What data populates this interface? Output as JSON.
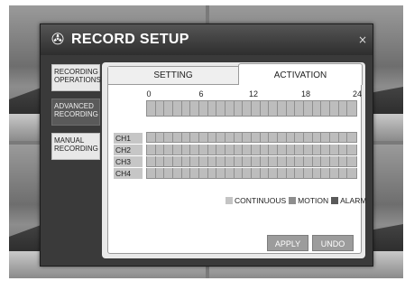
{
  "dialog": {
    "title": "RECORD SETUP",
    "close_symbol": "×",
    "title_icon_glyph": "✇"
  },
  "side_menu": [
    {
      "label": "RECORDING OPERATIONS",
      "active": true
    },
    {
      "label": "ADVANCED RECORDING",
      "active": false
    },
    {
      "label": "MANUAL RECORDING",
      "active": true
    }
  ],
  "tabs": {
    "setting": "SETTING",
    "activation": "ACTIVATION"
  },
  "hours": [
    "0",
    "6",
    "12",
    "18",
    "24"
  ],
  "channels": [
    "CH1",
    "CH2",
    "CH3",
    "CH4"
  ],
  "legend": {
    "continuous": "CONTINUOUS",
    "motion": "MOTION",
    "alarm": "ALARM",
    "colors": {
      "continuous": "#c4c4c4",
      "motion": "#8e8e8e",
      "alarm": "#5a5a5a"
    }
  },
  "buttons": {
    "apply": "APPLY",
    "undo": "UNDO"
  }
}
